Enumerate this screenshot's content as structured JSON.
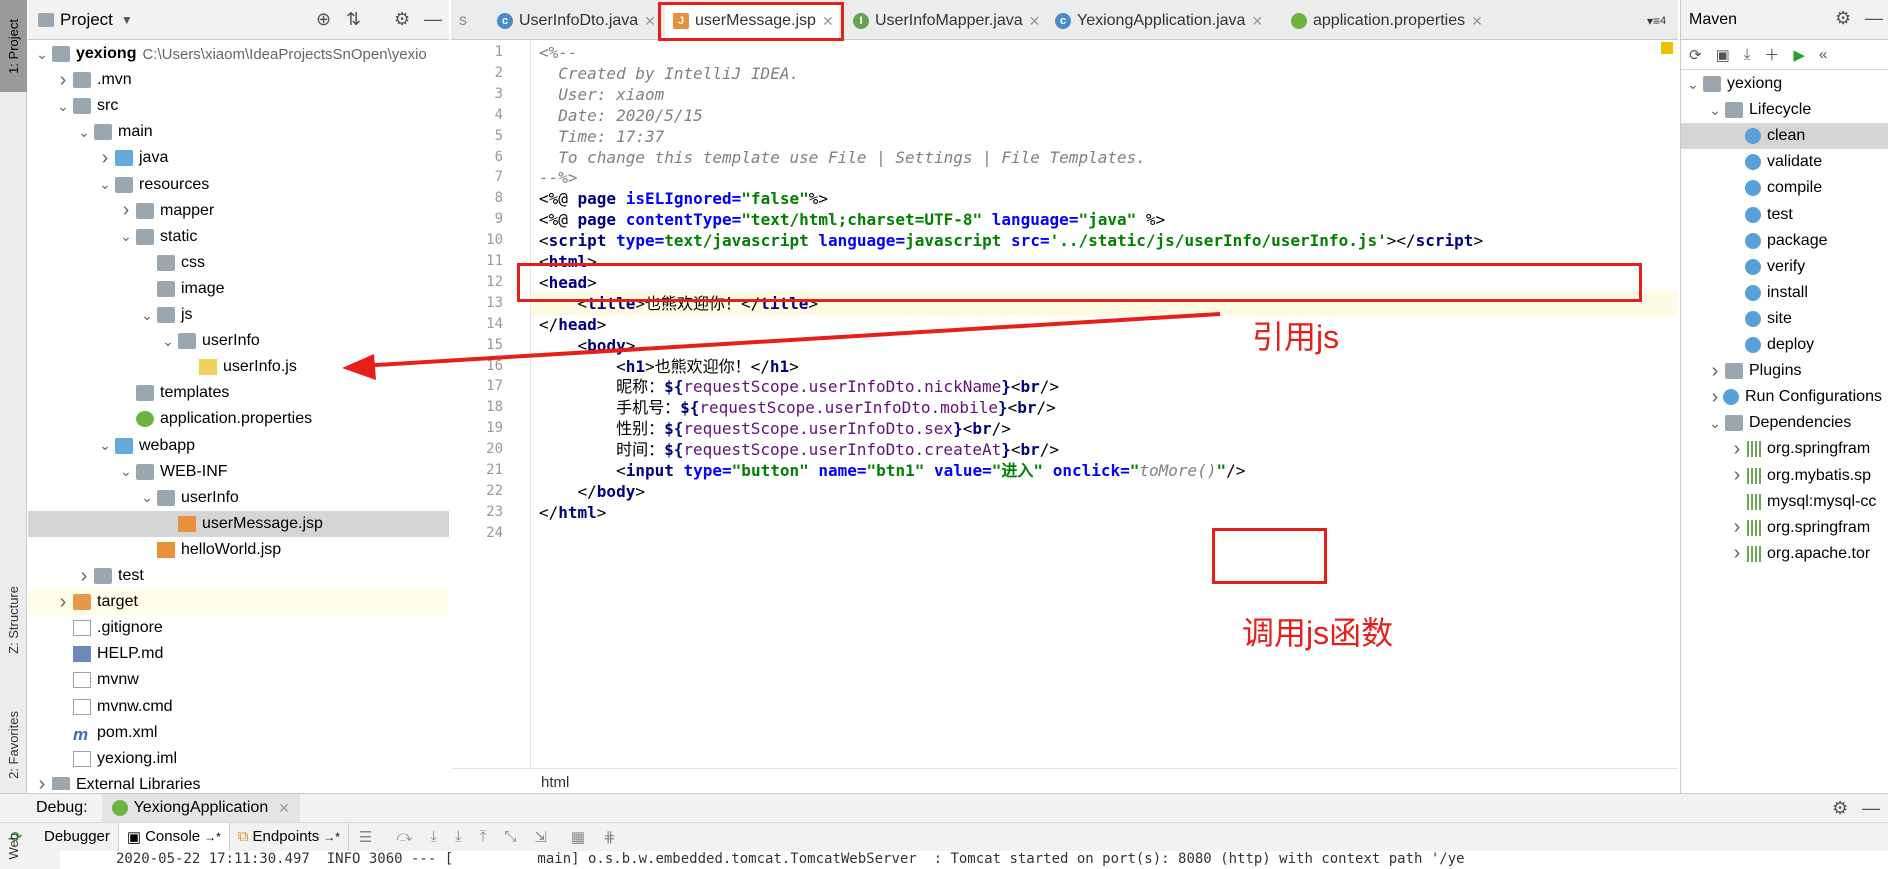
{
  "left_strip": {
    "project_tab": "1: Project",
    "structure_tab": "Z: Structure",
    "favorites_tab": "2: Favorites",
    "web_tab": "Web"
  },
  "project_panel": {
    "title": "Project",
    "tree": [
      {
        "label": "yexiong",
        "path": "C:\\Users\\xiaom\\IdeaProjectsSnOpen\\yexio",
        "depth": 0,
        "arrow": "down",
        "icon": "folder-icon",
        "bold": true
      },
      {
        "label": ".mvn",
        "depth": 1,
        "arrow": "right",
        "icon": "folder-icon"
      },
      {
        "label": "src",
        "depth": 1,
        "arrow": "down",
        "icon": "folder-icon"
      },
      {
        "label": "main",
        "depth": 2,
        "arrow": "down",
        "icon": "folder-icon"
      },
      {
        "label": "java",
        "depth": 3,
        "arrow": "right",
        "icon": "source-folder-icon"
      },
      {
        "label": "resources",
        "depth": 3,
        "arrow": "down",
        "icon": "resources-folder-icon"
      },
      {
        "label": "mapper",
        "depth": 4,
        "arrow": "right",
        "icon": "folder-icon"
      },
      {
        "label": "static",
        "depth": 4,
        "arrow": "down",
        "icon": "folder-icon"
      },
      {
        "label": "css",
        "depth": 5,
        "arrow": "",
        "icon": "folder-icon"
      },
      {
        "label": "image",
        "depth": 5,
        "arrow": "",
        "icon": "folder-icon"
      },
      {
        "label": "js",
        "depth": 5,
        "arrow": "down",
        "icon": "folder-icon"
      },
      {
        "label": "userInfo",
        "depth": 6,
        "arrow": "down",
        "icon": "folder-icon"
      },
      {
        "label": "userInfo.js",
        "depth": 7,
        "arrow": "",
        "icon": "js-file-icon"
      },
      {
        "label": "templates",
        "depth": 4,
        "arrow": "",
        "icon": "folder-icon"
      },
      {
        "label": "application.properties",
        "depth": 4,
        "arrow": "",
        "icon": "spring-leaf-icon"
      },
      {
        "label": "webapp",
        "depth": 3,
        "arrow": "down",
        "icon": "web-folder-icon"
      },
      {
        "label": "WEB-INF",
        "depth": 4,
        "arrow": "down",
        "icon": "folder-icon"
      },
      {
        "label": "userInfo",
        "depth": 5,
        "arrow": "down",
        "icon": "folder-icon"
      },
      {
        "label": "userMessage.jsp",
        "depth": 6,
        "arrow": "",
        "icon": "jsp-file-icon",
        "selected": true
      },
      {
        "label": "helloWorld.jsp",
        "depth": 5,
        "arrow": "",
        "icon": "jsp-file-icon"
      },
      {
        "label": "test",
        "depth": 2,
        "arrow": "right",
        "icon": "folder-icon"
      },
      {
        "label": "target",
        "depth": 1,
        "arrow": "right",
        "icon": "excluded-folder-icon",
        "highlight": true
      },
      {
        "label": ".gitignore",
        "depth": 1,
        "arrow": "",
        "icon": "text-file-icon"
      },
      {
        "label": "HELP.md",
        "depth": 1,
        "arrow": "",
        "icon": "md-file-icon"
      },
      {
        "label": "mvnw",
        "depth": 1,
        "arrow": "",
        "icon": "text-file-icon"
      },
      {
        "label": "mvnw.cmd",
        "depth": 1,
        "arrow": "",
        "icon": "text-file-icon"
      },
      {
        "label": "pom.xml",
        "depth": 1,
        "arrow": "",
        "icon": "maven-file-icon"
      },
      {
        "label": "yexiong.iml",
        "depth": 1,
        "arrow": "",
        "icon": "iml-file-icon"
      },
      {
        "label": "External Libraries",
        "depth": 0,
        "arrow": "right",
        "icon": "library-icon"
      }
    ]
  },
  "editor_tabs": {
    "overflow": "s",
    "tabs": [
      {
        "label": "UserInfoDto.java",
        "icon": "class-icon",
        "active": false
      },
      {
        "label": "userMessage.jsp",
        "icon": "jsp-file-icon",
        "active": true
      },
      {
        "label": "UserInfoMapper.java",
        "icon": "interface-icon",
        "active": false
      },
      {
        "label": "YexiongApplication.java",
        "icon": "spring-class-icon",
        "active": false
      },
      {
        "label": "application.properties",
        "icon": "spring-leaf-icon",
        "active": false
      }
    ],
    "tab_count": "4"
  },
  "editor": {
    "line_numbers": [
      "1",
      "2",
      "3",
      "4",
      "5",
      "6",
      "7",
      "8",
      "9",
      "10",
      "11",
      "12",
      "13",
      "14",
      "15",
      "16",
      "17",
      "18",
      "19",
      "20",
      "21",
      "22",
      "23",
      "24"
    ],
    "lines": [
      [
        {
          "t": "<%--",
          "c": "cmt"
        }
      ],
      [
        {
          "t": "  Created by IntelliJ IDEA.",
          "c": "cmt"
        }
      ],
      [
        {
          "t": "  User: xiaom",
          "c": "cmt"
        }
      ],
      [
        {
          "t": "  Date: 2020/5/15",
          "c": "cmt"
        }
      ],
      [
        {
          "t": "  Time: 17:37",
          "c": "cmt"
        }
      ],
      [
        {
          "t": "  To change this template use File | Settings | File Templates.",
          "c": "cmt"
        }
      ],
      [
        {
          "t": "--%>",
          "c": "cmt"
        }
      ],
      [
        {
          "t": "<%@ ",
          "c": "plain"
        },
        {
          "t": "page ",
          "c": "tag"
        },
        {
          "t": "isELIgnored=",
          "c": "attr"
        },
        {
          "t": "\"false\"",
          "c": "str"
        },
        {
          "t": "%>",
          "c": "plain"
        }
      ],
      [
        {
          "t": "<%@ ",
          "c": "plain"
        },
        {
          "t": "page ",
          "c": "tag"
        },
        {
          "t": "contentType=",
          "c": "attr"
        },
        {
          "t": "\"text/html;charset=UTF-8\" ",
          "c": "str"
        },
        {
          "t": "language=",
          "c": "attr"
        },
        {
          "t": "\"java\" ",
          "c": "str"
        },
        {
          "t": "%>",
          "c": "plain"
        }
      ],
      [
        {
          "t": "<",
          "c": "plain"
        },
        {
          "t": "script ",
          "c": "tag"
        },
        {
          "t": "type=",
          "c": "attr"
        },
        {
          "t": "text/javascript ",
          "c": "str"
        },
        {
          "t": "language=",
          "c": "attr"
        },
        {
          "t": "javascript ",
          "c": "str"
        },
        {
          "t": "src=",
          "c": "attr"
        },
        {
          "t": "'../static/js/userInfo/userInfo.js'",
          "c": "str"
        },
        {
          "t": "></",
          "c": "plain"
        },
        {
          "t": "script",
          "c": "tag"
        },
        {
          "t": ">",
          "c": "plain"
        }
      ],
      [
        {
          "t": "<",
          "c": "plain"
        },
        {
          "t": "html",
          "c": "tag"
        },
        {
          "t": ">",
          "c": "plain"
        }
      ],
      [
        {
          "t": "<",
          "c": "plain"
        },
        {
          "t": "head",
          "c": "tag"
        },
        {
          "t": ">",
          "c": "plain"
        }
      ],
      [
        {
          "t": "    <",
          "c": "plain"
        },
        {
          "t": "title",
          "c": "tag"
        },
        {
          "t": ">也熊欢迎你！</",
          "c": "plain"
        },
        {
          "t": "title",
          "c": "tag"
        },
        {
          "t": ">",
          "c": "plain"
        }
      ],
      [
        {
          "t": "</",
          "c": "plain"
        },
        {
          "t": "head",
          "c": "tag"
        },
        {
          "t": ">",
          "c": "plain"
        }
      ],
      [
        {
          "t": "    <",
          "c": "plain"
        },
        {
          "t": "body",
          "c": "tag"
        },
        {
          "t": ">",
          "c": "plain"
        }
      ],
      [
        {
          "t": "        <",
          "c": "plain"
        },
        {
          "t": "h1",
          "c": "tag"
        },
        {
          "t": ">也熊欢迎你！</",
          "c": "plain"
        },
        {
          "t": "h1",
          "c": "tag"
        },
        {
          "t": ">",
          "c": "plain"
        }
      ],
      [
        {
          "t": "        昵称：",
          "c": "plain"
        },
        {
          "t": "${",
          "c": "tag"
        },
        {
          "t": "requestScope.userInfoDto.nickName",
          "c": "el"
        },
        {
          "t": "}",
          "c": "tag"
        },
        {
          "t": "<",
          "c": "plain"
        },
        {
          "t": "br",
          "c": "tag"
        },
        {
          "t": "/>",
          "c": "plain"
        }
      ],
      [
        {
          "t": "        手机号：",
          "c": "plain"
        },
        {
          "t": "${",
          "c": "tag"
        },
        {
          "t": "requestScope.userInfoDto.mobile",
          "c": "el"
        },
        {
          "t": "}",
          "c": "tag"
        },
        {
          "t": "<",
          "c": "plain"
        },
        {
          "t": "br",
          "c": "tag"
        },
        {
          "t": "/>",
          "c": "plain"
        }
      ],
      [
        {
          "t": "        性别：",
          "c": "plain"
        },
        {
          "t": "${",
          "c": "tag"
        },
        {
          "t": "requestScope.userInfoDto.sex",
          "c": "el"
        },
        {
          "t": "}",
          "c": "tag"
        },
        {
          "t": "<",
          "c": "plain"
        },
        {
          "t": "br",
          "c": "tag"
        },
        {
          "t": "/>",
          "c": "plain"
        }
      ],
      [
        {
          "t": "        时间：",
          "c": "plain"
        },
        {
          "t": "${",
          "c": "tag"
        },
        {
          "t": "requestScope.userInfoDto.createAt",
          "c": "el"
        },
        {
          "t": "}",
          "c": "tag"
        },
        {
          "t": "<",
          "c": "plain"
        },
        {
          "t": "br",
          "c": "tag"
        },
        {
          "t": "/>",
          "c": "plain"
        }
      ],
      [
        {
          "t": "        <",
          "c": "plain"
        },
        {
          "t": "input ",
          "c": "tag"
        },
        {
          "t": "type=",
          "c": "attr"
        },
        {
          "t": "\"button\" ",
          "c": "str"
        },
        {
          "t": "name=",
          "c": "attr"
        },
        {
          "t": "\"btn1\" ",
          "c": "str"
        },
        {
          "t": "value=",
          "c": "attr"
        },
        {
          "t": "\"进入\" ",
          "c": "str"
        },
        {
          "t": "onclick=",
          "c": "attr"
        },
        {
          "t": "\"",
          "c": "str"
        },
        {
          "t": "toMore()",
          "c": "cmt"
        },
        {
          "t": "\"",
          "c": "str"
        },
        {
          "t": "/>",
          "c": "plain"
        }
      ],
      [
        {
          "t": "    </",
          "c": "plain"
        },
        {
          "t": "body",
          "c": "tag"
        },
        {
          "t": ">",
          "c": "plain"
        }
      ],
      [
        {
          "t": "</",
          "c": "plain"
        },
        {
          "t": "html",
          "c": "tag"
        },
        {
          "t": ">",
          "c": "plain"
        }
      ],
      [
        {
          "t": "",
          "c": "plain"
        }
      ]
    ],
    "breadcrumb": "html",
    "annotation_js": "引用js",
    "annotation_func": "调用js函数"
  },
  "maven_panel": {
    "title": "Maven",
    "tree": [
      {
        "label": "yexiong",
        "depth": 0,
        "arrow": "down",
        "icon": "maven-module-icon"
      },
      {
        "label": "Lifecycle",
        "depth": 1,
        "arrow": "down",
        "icon": "lifecycle-folder-icon"
      },
      {
        "label": "clean",
        "depth": 2,
        "arrow": "",
        "icon": "gear-icon",
        "selected": true
      },
      {
        "label": "validate",
        "depth": 2,
        "arrow": "",
        "icon": "gear-icon"
      },
      {
        "label": "compile",
        "depth": 2,
        "arrow": "",
        "icon": "gear-icon"
      },
      {
        "label": "test",
        "depth": 2,
        "arrow": "",
        "icon": "gear-icon"
      },
      {
        "label": "package",
        "depth": 2,
        "arrow": "",
        "icon": "gear-icon"
      },
      {
        "label": "verify",
        "depth": 2,
        "arrow": "",
        "icon": "gear-icon"
      },
      {
        "label": "install",
        "depth": 2,
        "arrow": "",
        "icon": "gear-icon"
      },
      {
        "label": "site",
        "depth": 2,
        "arrow": "",
        "icon": "gear-icon"
      },
      {
        "label": "deploy",
        "depth": 2,
        "arrow": "",
        "icon": "gear-icon"
      },
      {
        "label": "Plugins",
        "depth": 1,
        "arrow": "right",
        "icon": "plugins-folder-icon"
      },
      {
        "label": "Run Configurations",
        "depth": 1,
        "arrow": "right",
        "icon": "gear-icon"
      },
      {
        "label": "Dependencies",
        "depth": 1,
        "arrow": "down",
        "icon": "dependencies-folder-icon"
      },
      {
        "label": "org.springfram",
        "depth": 2,
        "arrow": "right",
        "icon": "library-icon"
      },
      {
        "label": "org.mybatis.sp",
        "depth": 2,
        "arrow": "right",
        "icon": "library-icon"
      },
      {
        "label": "mysql:mysql-cc",
        "depth": 2,
        "arrow": "",
        "icon": "library-icon"
      },
      {
        "label": "org.springfram",
        "depth": 2,
        "arrow": "right",
        "icon": "library-icon"
      },
      {
        "label": "org.apache.tor",
        "depth": 2,
        "arrow": "right",
        "icon": "library-icon"
      }
    ]
  },
  "debug": {
    "label": "Debug:",
    "config": "YexiongApplication",
    "tabs": [
      "Debugger",
      "Console",
      "Endpoints"
    ],
    "console_line": "2020-05-22 17:11:30.497  INFO 3060 --- [          main] o.s.b.w.embedded.tomcat.TomcatWebServer  : Tomcat started on port(s): 8080 (http) with context path '/ye"
  },
  "colors": {
    "annotation_red": "#e5201b"
  }
}
